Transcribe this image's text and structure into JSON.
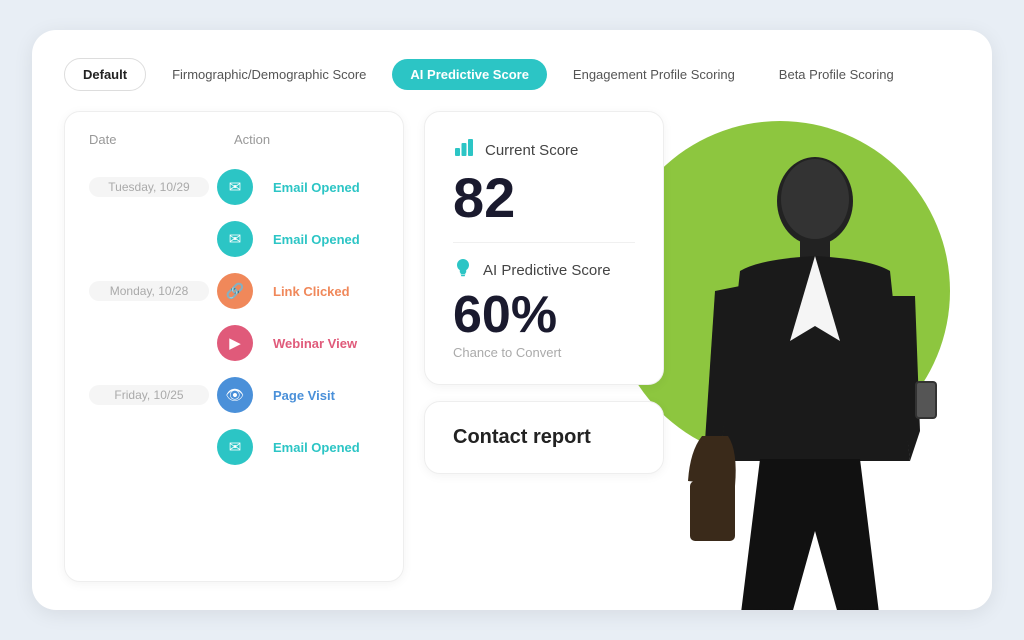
{
  "tabs": [
    {
      "id": "default",
      "label": "Default",
      "state": "active-default"
    },
    {
      "id": "firmographic",
      "label": "Firmographic/Demographic Score",
      "state": "normal"
    },
    {
      "id": "ai-predictive",
      "label": "AI Predictive Score",
      "state": "active-ai"
    },
    {
      "id": "engagement",
      "label": "Engagement Profile Scoring",
      "state": "normal"
    },
    {
      "id": "beta",
      "label": "Beta Profile Scoring",
      "state": "normal"
    }
  ],
  "activity": {
    "col1": "Date",
    "col2": "Action",
    "rows": [
      {
        "date": "Tuesday, 10/29",
        "icon": "email",
        "iconColor": "teal",
        "label": "Email Opened",
        "labelColor": "teal"
      },
      {
        "date": "",
        "icon": "email",
        "iconColor": "teal",
        "label": "Email Opened",
        "labelColor": "teal"
      },
      {
        "date": "Monday, 10/28",
        "icon": "link",
        "iconColor": "orange",
        "label": "Link Clicked",
        "labelColor": "orange"
      },
      {
        "date": "",
        "icon": "webinar",
        "iconColor": "pink",
        "label": "Webinar View",
        "labelColor": "pink"
      },
      {
        "date": "Friday, 10/25",
        "icon": "page",
        "iconColor": "blue",
        "label": "Page Visit",
        "labelColor": "blue"
      },
      {
        "date": "",
        "icon": "email",
        "iconColor": "teal",
        "label": "Email Opened",
        "labelColor": "teal"
      }
    ]
  },
  "scoreCard": {
    "currentScoreLabel": "Current Score",
    "currentScoreValue": "82",
    "predictiveScoreLabel": "AI Predictive Score",
    "predictiveScoreValue": "60%",
    "chanceLabel": "Chance to Convert"
  },
  "contactCard": {
    "title": "Contact report"
  },
  "icons": {
    "email": "✉",
    "link": "🔗",
    "webinar": "▶",
    "page": "👁",
    "barChart": "📊",
    "lightbulb": "💡"
  }
}
